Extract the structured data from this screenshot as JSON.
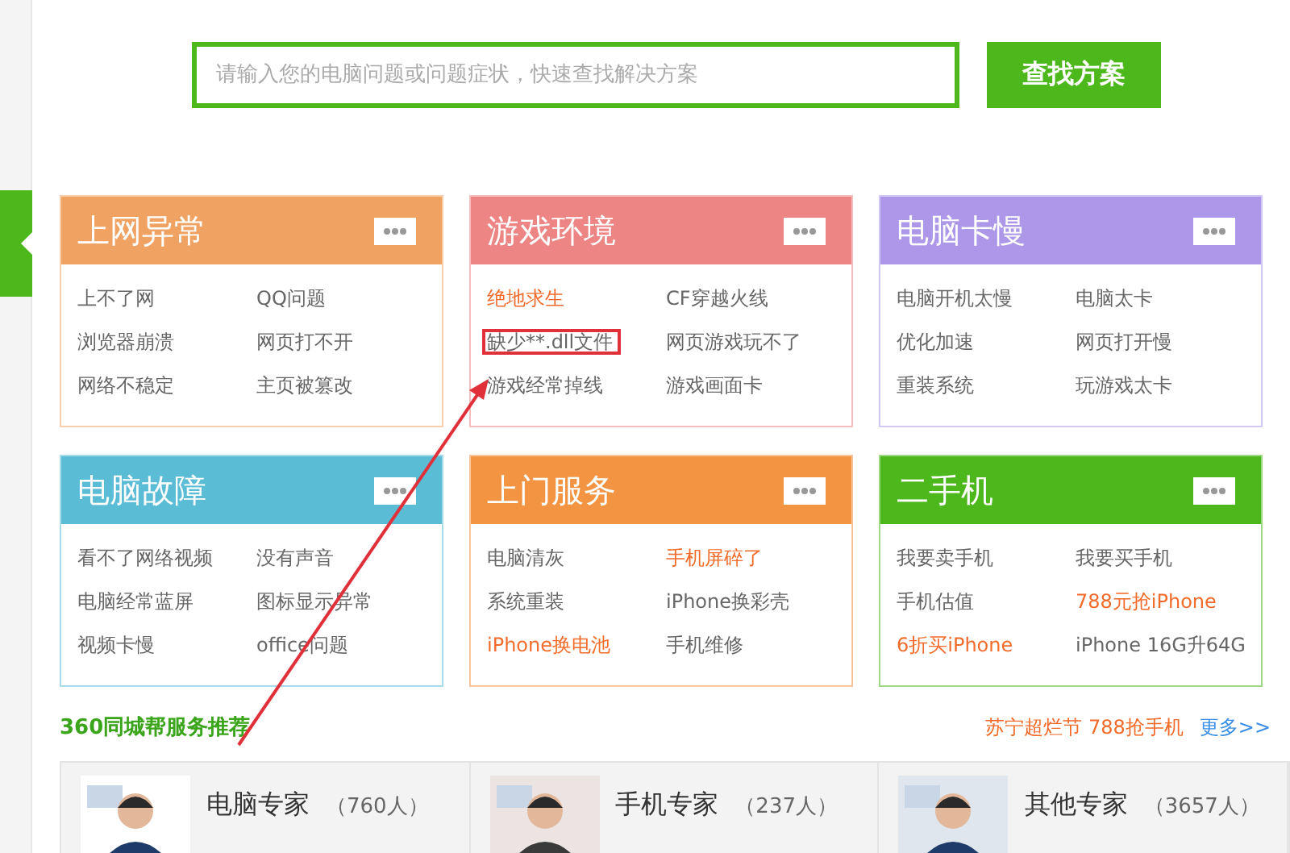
{
  "search": {
    "placeholder": "请输入您的电脑问题或问题症状，快速查找解决方案",
    "button": "查找方案"
  },
  "categories": [
    {
      "title": "上网异常",
      "color": "#f0a262",
      "items": [
        {
          "label": "上不了网",
          "highlight": false
        },
        {
          "label": "QQ问题",
          "highlight": false
        },
        {
          "label": "浏览器崩溃",
          "highlight": false
        },
        {
          "label": "网页打不开",
          "highlight": false
        },
        {
          "label": "网络不稳定",
          "highlight": false
        },
        {
          "label": "主页被篡改",
          "highlight": false
        }
      ]
    },
    {
      "title": "游戏环境",
      "color": "#ec8584",
      "items": [
        {
          "label": "绝地求生",
          "highlight": true
        },
        {
          "label": "CF穿越火线",
          "highlight": false
        },
        {
          "label": "缺少**.dll文件",
          "highlight": false,
          "marked": true
        },
        {
          "label": "网页游戏玩不了",
          "highlight": false
        },
        {
          "label": "游戏经常掉线",
          "highlight": false
        },
        {
          "label": "游戏画面卡",
          "highlight": false
        }
      ]
    },
    {
      "title": "电脑卡慢",
      "color": "#ad97e8",
      "items": [
        {
          "label": "电脑开机太慢",
          "highlight": false
        },
        {
          "label": "电脑太卡",
          "highlight": false
        },
        {
          "label": "优化加速",
          "highlight": false
        },
        {
          "label": "网页打开慢",
          "highlight": false
        },
        {
          "label": "重装系统",
          "highlight": false
        },
        {
          "label": "玩游戏太卡",
          "highlight": false
        }
      ]
    },
    {
      "title": "电脑故障",
      "color": "#5bbcd6",
      "items": [
        {
          "label": "看不了网络视频",
          "highlight": false
        },
        {
          "label": "没有声音",
          "highlight": false
        },
        {
          "label": "电脑经常蓝屏",
          "highlight": false
        },
        {
          "label": "图标显示异常",
          "highlight": false
        },
        {
          "label": "视频卡慢",
          "highlight": false
        },
        {
          "label": "office问题",
          "highlight": false
        }
      ]
    },
    {
      "title": "上门服务",
      "color": "#f39443",
      "items": [
        {
          "label": "电脑清灰",
          "highlight": false
        },
        {
          "label": "手机屏碎了",
          "highlight": true
        },
        {
          "label": "系统重装",
          "highlight": false
        },
        {
          "label": "iPhone换彩壳",
          "highlight": false
        },
        {
          "label": "iPhone换电池",
          "highlight": true
        },
        {
          "label": "手机维修",
          "highlight": false
        }
      ]
    },
    {
      "title": "二手机",
      "color": "#4cb81c",
      "items": [
        {
          "label": "我要卖手机",
          "highlight": false
        },
        {
          "label": "我要买手机",
          "highlight": false
        },
        {
          "label": "手机估值",
          "highlight": false
        },
        {
          "label": "788元抢iPhone",
          "highlight": true
        },
        {
          "label": "6折买iPhone",
          "highlight": true
        },
        {
          "label": "iPhone 16G升64G",
          "highlight": false
        }
      ]
    }
  ],
  "section": {
    "title": "360同城帮服务推荐",
    "promo": "苏宁超烂节 788抢手机",
    "more": "更多>>"
  },
  "experts": [
    {
      "name": "电脑专家",
      "count": "（760人）"
    },
    {
      "name": "手机专家",
      "count": "（237人）"
    },
    {
      "name": "其他专家",
      "count": "（3657人）"
    }
  ]
}
